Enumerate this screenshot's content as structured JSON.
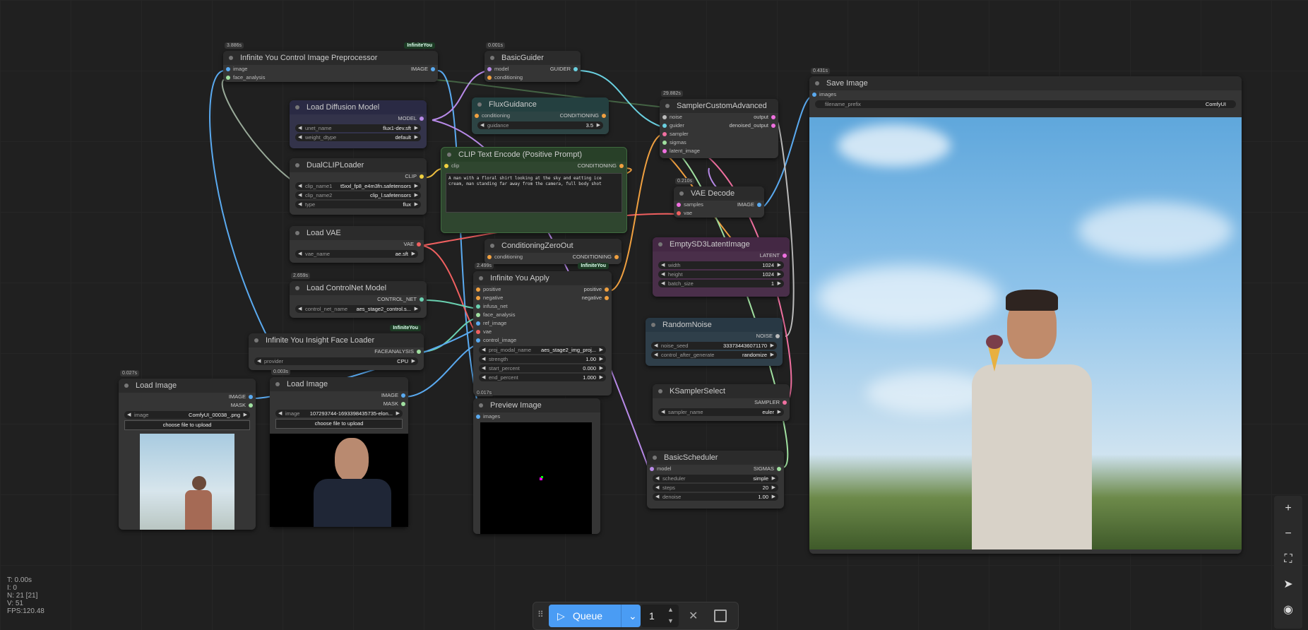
{
  "nodes": {
    "preproc": {
      "badge": "3.886s",
      "tag": "InfiniteYou",
      "title": "Infinite You Control Image Preprocessor",
      "inputs": [
        "image",
        "face_analysis"
      ],
      "outputs": [
        "IMAGE"
      ]
    },
    "basic_guider": {
      "badge": "0.001s",
      "title": "BasicGuider",
      "inputs": [
        "model",
        "conditioning"
      ],
      "outputs": [
        "GUIDER"
      ]
    },
    "load_diffusion": {
      "title": "Load Diffusion Model",
      "outputs": [
        "MODEL"
      ],
      "widgets": [
        {
          "label": "unet_name",
          "value": "flux1-dev.sft"
        },
        {
          "label": "weight_dtype",
          "value": "default"
        }
      ]
    },
    "flux_guidance": {
      "title": "FluxGuidance",
      "inputs": [
        "conditioning"
      ],
      "outputs": [
        "CONDITIONING"
      ],
      "widgets": [
        {
          "label": "guidance",
          "value": "3.5"
        }
      ]
    },
    "sampler_custom": {
      "badge": "29.882s",
      "title": "SamplerCustomAdvanced",
      "inputs": [
        "noise",
        "guider",
        "sampler",
        "sigmas",
        "latent_image"
      ],
      "outputs": [
        "output",
        "denoised_output"
      ]
    },
    "save_image": {
      "badge": "0.431s",
      "title": "Save Image",
      "inputs": [
        "images"
      ],
      "widgets": [
        {
          "label": "filename_prefix",
          "value": "ComfyUI"
        }
      ]
    },
    "dual_clip": {
      "title": "DualCLIPLoader",
      "outputs": [
        "CLIP"
      ],
      "widgets": [
        {
          "label": "clip_name1",
          "value": "t5xxl_fp8_e4m3fn.safetensors"
        },
        {
          "label": "clip_name2",
          "value": "clip_l.safetensors"
        },
        {
          "label": "type",
          "value": "flux"
        }
      ]
    },
    "clip_text": {
      "title": "CLIP Text Encode (Positive Prompt)",
      "inputs": [
        "clip"
      ],
      "outputs": [
        "CONDITIONING"
      ],
      "prompt": "A man with a floral shirt looking at the sky and eatting ice cream, man standing far away from the camera, full body shot"
    },
    "vae_decode": {
      "badge": "0.210s",
      "title": "VAE Decode",
      "inputs": [
        "samples",
        "vae"
      ],
      "outputs": [
        "IMAGE"
      ]
    },
    "load_vae": {
      "title": "Load VAE",
      "outputs": [
        "VAE"
      ],
      "widgets": [
        {
          "label": "vae_name",
          "value": "ae.sft"
        }
      ]
    },
    "cond_zero": {
      "title": "ConditioningZeroOut",
      "inputs": [
        "conditioning"
      ],
      "outputs": [
        "CONDITIONING"
      ]
    },
    "empty_latent": {
      "title": "EmptySD3LatentImage",
      "outputs": [
        "LATENT"
      ],
      "widgets": [
        {
          "label": "width",
          "value": "1024"
        },
        {
          "label": "height",
          "value": "1024"
        },
        {
          "label": "batch_size",
          "value": "1"
        }
      ]
    },
    "controlnet": {
      "badge": "2.659s",
      "title": "Load ControlNet Model",
      "outputs": [
        "CONTROL_NET"
      ],
      "widgets": [
        {
          "label": "control_net_name",
          "value": "aes_stage2_control.s..."
        }
      ]
    },
    "iy_apply": {
      "badge": "2.499s",
      "tag": "InfiniteYou",
      "title": "Infinite You Apply",
      "inputs": [
        "positive",
        "negative",
        "infusa_net",
        "face_analysis",
        "ref_image",
        "vae",
        "control_image"
      ],
      "outputs": [
        "positive",
        "negative"
      ],
      "widgets": [
        {
          "label": "proj_modal_name",
          "value": "aes_stage2_img_proj..."
        },
        {
          "label": "strength",
          "value": "1.00"
        },
        {
          "label": "start_percent",
          "value": "0.000"
        },
        {
          "label": "end_percent",
          "value": "1.000"
        }
      ]
    },
    "random_noise": {
      "title": "RandomNoise",
      "outputs": [
        "NOISE"
      ],
      "widgets": [
        {
          "label": "noise_seed",
          "value": "333734436071170"
        },
        {
          "label": "control_after_generate",
          "value": "randomize"
        }
      ]
    },
    "face_loader": {
      "tag": "InfiniteYou",
      "title": "Infinite You Insight Face Loader",
      "outputs": [
        "FACEANALYSIS"
      ],
      "widgets": [
        {
          "label": "provider",
          "value": "CPU"
        }
      ]
    },
    "load_image1": {
      "badge": "0.027s",
      "title": "Load Image",
      "outputs": [
        "IMAGE",
        "MASK"
      ],
      "widgets": [
        {
          "label": "image",
          "value": "ComfyUI_00038_.png"
        }
      ],
      "upload": "choose file to upload"
    },
    "load_image2": {
      "badge": "0.003s",
      "title": "Load Image",
      "outputs": [
        "IMAGE",
        "MASK"
      ],
      "widgets": [
        {
          "label": "image",
          "value": "107293744-1693398435735-elon..."
        }
      ],
      "upload": "choose file to upload"
    },
    "preview": {
      "badge": "0.017s",
      "title": "Preview Image",
      "inputs": [
        "images"
      ]
    },
    "ksampler_select": {
      "title": "KSamplerSelect",
      "outputs": [
        "SAMPLER"
      ],
      "widgets": [
        {
          "label": "sampler_name",
          "value": "euler"
        }
      ]
    },
    "basic_scheduler": {
      "title": "BasicScheduler",
      "inputs": [
        "model"
      ],
      "outputs": [
        "SIGMAS"
      ],
      "widgets": [
        {
          "label": "scheduler",
          "value": "simple"
        },
        {
          "label": "steps",
          "value": "20"
        },
        {
          "label": "denoise",
          "value": "1.00"
        }
      ]
    }
  },
  "status": {
    "t": "T: 0.00s",
    "i": "I: 0",
    "n": "N: 21 [21]",
    "v": "V: 51",
    "fps": "FPS:120.48"
  },
  "queue": {
    "label": "Queue",
    "count": "1"
  },
  "colors": {
    "clip_node": "#2a4a2a",
    "latent_node": "#4a2a4a",
    "flux_node": "#2a4444",
    "noise_node": "#2a3a44",
    "model_node": "#333355",
    "accent": "#4a9cf4"
  }
}
